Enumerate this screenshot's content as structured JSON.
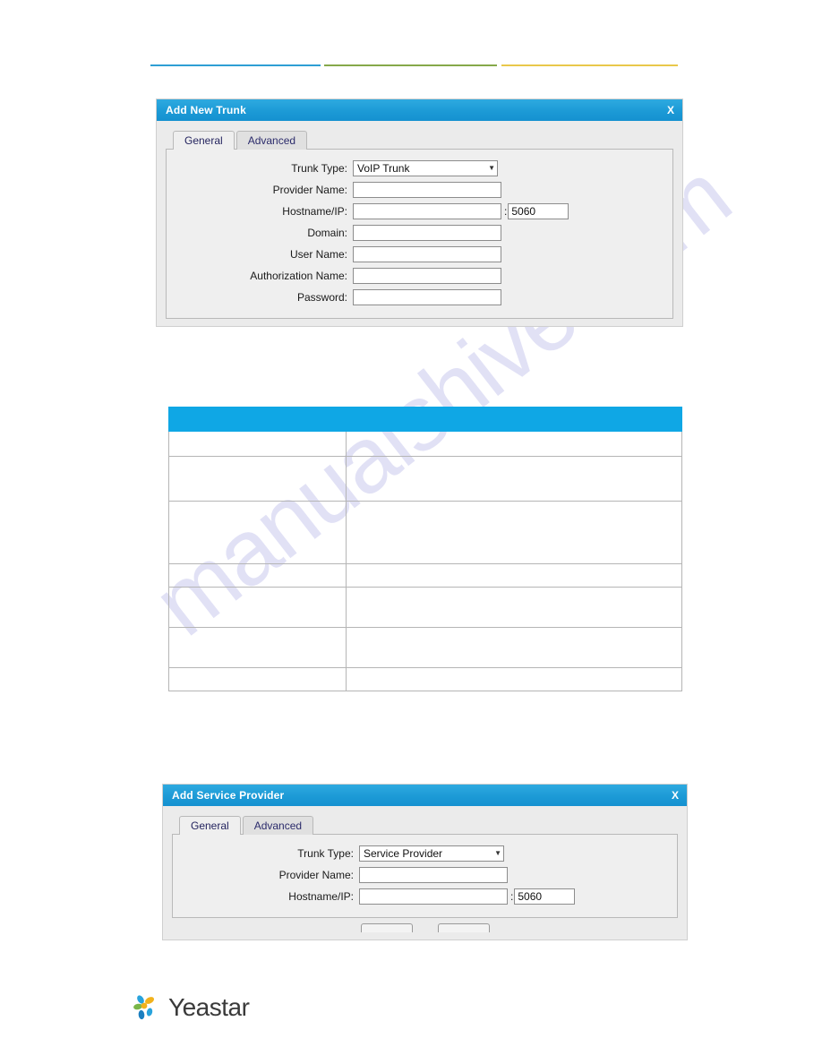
{
  "page": {
    "watermark": "manualshive.com",
    "rules": [
      {
        "name": "rule-blue",
        "color": "#2e9fd4"
      },
      {
        "name": "rule-green",
        "color": "#86a84a"
      },
      {
        "name": "rule-yellow",
        "color": "#e9c84b"
      }
    ]
  },
  "dialog_trunk": {
    "title": "Add New Trunk",
    "close_label": "X",
    "tabs": [
      {
        "label": "General",
        "active": true
      },
      {
        "label": "Advanced",
        "active": false
      }
    ],
    "fields": [
      {
        "label": "Trunk Type:",
        "type": "select",
        "value": "VoIP Trunk"
      },
      {
        "label": "Provider Name:",
        "type": "text",
        "value": ""
      },
      {
        "label": "Hostname/IP:",
        "type": "text",
        "value": "",
        "port_sep": ":",
        "port": "5060"
      },
      {
        "label": "Domain:",
        "type": "text",
        "value": ""
      },
      {
        "label": "User Name:",
        "type": "text",
        "value": ""
      },
      {
        "label": "Authorization Name:",
        "type": "text",
        "value": ""
      },
      {
        "label": "Password:",
        "type": "text",
        "value": ""
      }
    ]
  },
  "spec_table": {
    "headers": [
      "",
      ""
    ],
    "rows": [
      [
        "",
        ""
      ],
      [
        "",
        ""
      ],
      [
        "",
        ""
      ],
      [
        "",
        ""
      ],
      [
        "",
        ""
      ],
      [
        "",
        ""
      ],
      [
        "",
        ""
      ]
    ]
  },
  "dialog_provider": {
    "title": "Add Service Provider",
    "close_label": "X",
    "tabs": [
      {
        "label": "General",
        "active": true
      },
      {
        "label": "Advanced",
        "active": false
      }
    ],
    "fields": [
      {
        "label": "Trunk Type:",
        "type": "select",
        "value": "Service Provider"
      },
      {
        "label": "Provider Name:",
        "type": "text",
        "value": ""
      },
      {
        "label": "Hostname/IP:",
        "type": "text",
        "value": "",
        "port_sep": ":",
        "port": "5060"
      }
    ]
  },
  "footer": {
    "logo_text": "Yeastar",
    "logo_colors": {
      "yellow": "#f2b21c",
      "green": "#7ab648",
      "blue_light": "#29a3dc",
      "blue_dark": "#1b7fc0"
    }
  }
}
